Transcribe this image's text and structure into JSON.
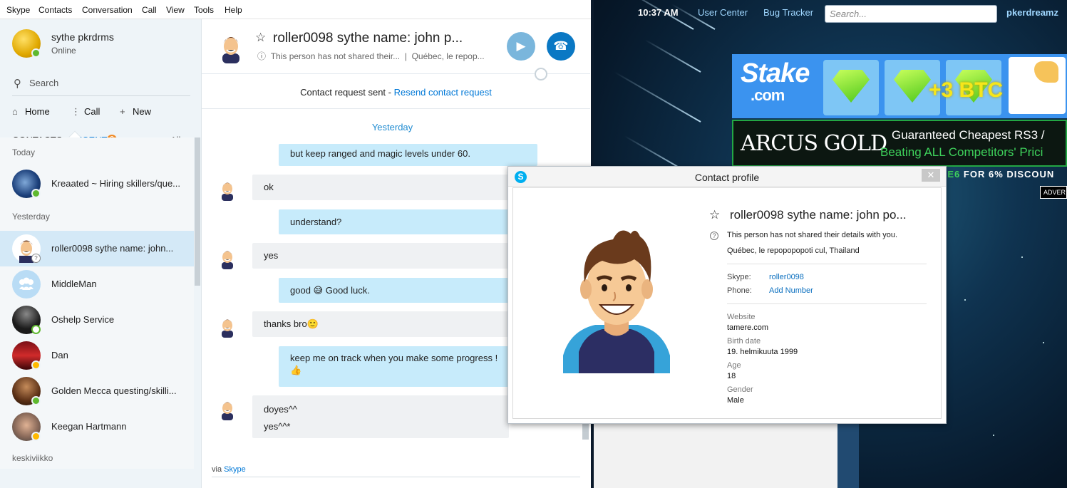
{
  "browser": {
    "clock": "10:37 AM",
    "links": [
      "User Center",
      "Bug Tracker"
    ],
    "search_placeholder": "Search...",
    "username": "pkerdreamz",
    "ads": {
      "stake_logo": "Stake",
      "stake_domain": ".com",
      "stake_bonus": "+3 BTC",
      "arcus_logo": "ARCUS GOLD",
      "arcus_line1": "Guaranteed Cheapest RS3 /",
      "arcus_line2": "Beating ALL Competitors' Prici",
      "promo_code": "HE6",
      "promo_text": " FOR 6% DISCOUN",
      "adver": "ADVER"
    }
  },
  "menubar": [
    "Skype",
    "Contacts",
    "Conversation",
    "Call",
    "View",
    "Tools",
    "Help"
  ],
  "me": {
    "name": "sythe pkrdrms",
    "status": "Online"
  },
  "search": {
    "label": "Search"
  },
  "nav": {
    "home": "Home",
    "call": "Call",
    "new": "New"
  },
  "tabs": {
    "contacts": "CONTACTS",
    "recent": "RECENT",
    "badge": "2",
    "filter": "All"
  },
  "contact_groups": {
    "today": "Today",
    "yesterday": "Yesterday",
    "older": "keskiviikko"
  },
  "contacts": [
    {
      "name": "Kreaated ~ Hiring skillers/que...",
      "status": "online"
    },
    {
      "name": "roller0098 sythe name: john...",
      "status": "unknown"
    },
    {
      "name": "MiddleMan",
      "status": "none"
    },
    {
      "name": "Oshelp Service",
      "status": "offline"
    },
    {
      "name": "Dan",
      "status": "away"
    },
    {
      "name": "Golden Mecca  questing/skilli...",
      "status": "online"
    },
    {
      "name": "Keegan Hartmann",
      "status": "away"
    }
  ],
  "chat": {
    "name": "roller0098 sythe name: john p...",
    "subtitle": "This person has not shared their...",
    "location": "Québec, le repop...",
    "request_text": "Contact request sent - ",
    "request_link": "Resend contact request",
    "date_separator": "Yesterday",
    "messages": [
      {
        "dir": "out",
        "text": "but keep ranged and magic levels under 60."
      },
      {
        "dir": "in",
        "text": "ok"
      },
      {
        "dir": "out",
        "text": "understand?"
      },
      {
        "dir": "in",
        "text": "yes"
      },
      {
        "dir": "out",
        "text": "good",
        "emoji": "😅",
        "text2": "Good luck."
      },
      {
        "dir": "in",
        "text": "thanks bro",
        "emoji": "🙂"
      },
      {
        "dir": "out",
        "text": "keep me on track when you make some progress !",
        "emoji": "👍"
      },
      {
        "dir": "in",
        "text": "doyes^^",
        "text2": "yes^^*"
      }
    ],
    "via_prefix": "via ",
    "via_link": "Skype"
  },
  "profile": {
    "title": "Contact profile",
    "name": "roller0098 sythe name: john po...",
    "shared": "This person has not shared their details with you.",
    "location": "Québec, le repopopopoti cul, Thailand",
    "skype_label": "Skype:",
    "skype_value": "roller0098",
    "phone_label": "Phone:",
    "phone_value": "Add Number",
    "fields": [
      {
        "label": "Website",
        "value": "tamere.com"
      },
      {
        "label": "Birth date",
        "value": "19. helmikuuta 1999"
      },
      {
        "label": "Age",
        "value": "18"
      },
      {
        "label": "Gender",
        "value": "Male"
      }
    ]
  },
  "colors": {
    "skype_blue": "#0078d7",
    "accent_orange": "#f08a24",
    "online": "#5fb92f",
    "away": "#ffb900"
  }
}
